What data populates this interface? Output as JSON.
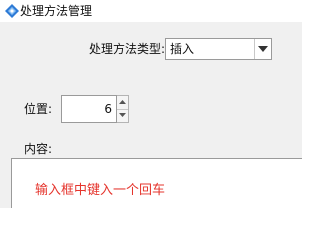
{
  "window": {
    "title": "处理方法管理",
    "icon": "app-diamond-icon"
  },
  "form": {
    "type_label": "处理方法类型:",
    "type_value": "插入",
    "position_label": "位置:",
    "position_value": "6",
    "content_label": "内容:"
  },
  "annotation": {
    "text": "输入框中键入一个回车",
    "color": "#e5342c"
  },
  "colors": {
    "icon_blue": "#2e7bd6",
    "panel_bg": "#f0f0f0"
  }
}
